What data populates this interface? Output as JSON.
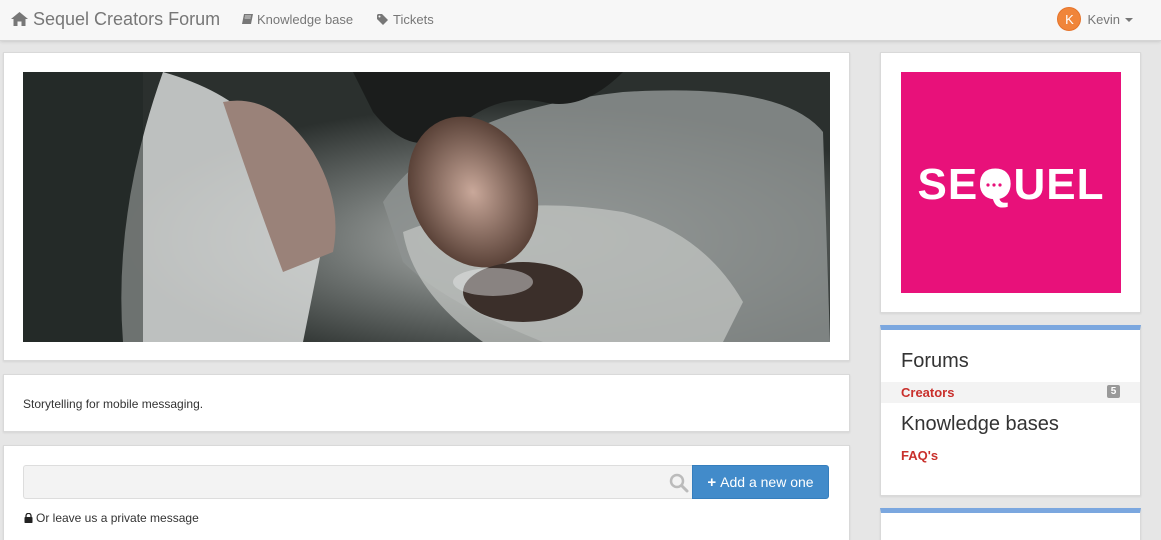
{
  "navbar": {
    "brand": "Sequel Creators Forum",
    "links": [
      {
        "label": "Knowledge base",
        "icon": "book-icon"
      },
      {
        "label": "Tickets",
        "icon": "tag-icon"
      }
    ],
    "user": {
      "initial": "K",
      "name": "Kevin"
    }
  },
  "main": {
    "tagline": "Storytelling for mobile messaging.",
    "search": {
      "placeholder": "",
      "value": ""
    },
    "add_button": "Add a new one",
    "private_message": "Or leave us a private message"
  },
  "sidebar": {
    "logo_text": "SEQUEL",
    "forums": {
      "title": "Forums",
      "items": [
        {
          "label": "Creators",
          "count": "5"
        }
      ]
    },
    "knowledge_bases": {
      "title": "Knowledge bases",
      "items": [
        {
          "label": "FAQ's"
        }
      ]
    }
  },
  "colors": {
    "accent": "#428bca",
    "brand": "#e8117a",
    "link": "#c9302c",
    "panel_border_top": "#7ba7df",
    "avatar": "#f0853a"
  }
}
